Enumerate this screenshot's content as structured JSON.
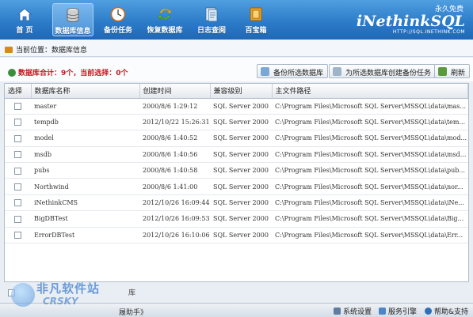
{
  "toolbar": {
    "items": [
      {
        "label": "首 页",
        "icon": "home-icon"
      },
      {
        "label": "数据库信息",
        "icon": "database-icon"
      },
      {
        "label": "备份任务",
        "icon": "clock-icon"
      },
      {
        "label": "恢复数据库",
        "icon": "restore-icon"
      },
      {
        "label": "日志查阅",
        "icon": "log-icon"
      },
      {
        "label": "百宝箱",
        "icon": "toolbox-icon"
      }
    ],
    "active_index": 1
  },
  "brand": {
    "slogan": "永久免费",
    "logo": "iNethinkSQL",
    "url": "HTTP://SQL.INETHINK.COM"
  },
  "breadcrumb": {
    "prefix": "当前位置：",
    "current": "数据库信息"
  },
  "summary": {
    "text": "数据库合计：9个，当前选择：0个"
  },
  "buttons": {
    "backup_selected": "备份所选数据库",
    "create_task": "为所选数据库创建备份任务",
    "refresh": "刷新"
  },
  "table": {
    "columns": [
      "选择",
      "数据库名称",
      "创建时间",
      "兼容级别",
      "主文件路径"
    ],
    "rows": [
      {
        "name": "master",
        "created": "2000/8/6 1:29:12",
        "compat": "SQL Server 2000",
        "path": "C:\\Program Files\\Microsoft SQL Server\\MSSQL\\data\\mas..."
      },
      {
        "name": "tempdb",
        "created": "2012/10/22 15:26:31",
        "compat": "SQL Server 2000",
        "path": "C:\\Program Files\\Microsoft SQL Server\\MSSQL\\data\\tem..."
      },
      {
        "name": "model",
        "created": "2000/8/6 1:40:52",
        "compat": "SQL Server 2000",
        "path": "C:\\Program Files\\Microsoft SQL Server\\MSSQL\\data\\mod..."
      },
      {
        "name": "msdb",
        "created": "2000/8/6 1:40:56",
        "compat": "SQL Server 2000",
        "path": "C:\\Program Files\\Microsoft SQL Server\\MSSQL\\data\\msd..."
      },
      {
        "name": "pubs",
        "created": "2000/8/6 1:40:58",
        "compat": "SQL Server 2000",
        "path": "C:\\Program Files\\Microsoft SQL Server\\MSSQL\\data\\pub..."
      },
      {
        "name": "Northwind",
        "created": "2000/8/6 1:41:00",
        "compat": "SQL Server 2000",
        "path": "C:\\Program Files\\Microsoft SQL Server\\MSSQL\\data\\nor..."
      },
      {
        "name": "iNethinkCMS",
        "created": "2012/10/26 16:09:44",
        "compat": "SQL Server 2000",
        "path": "C:\\Program Files\\Microsoft SQL Server\\MSSQL\\data\\iNe..."
      },
      {
        "name": "BigDBTest",
        "created": "2012/10/26 16:09:53",
        "compat": "SQL Server 2000",
        "path": "C:\\Program Files\\Microsoft SQL Server\\MSSQL\\data\\Big..."
      },
      {
        "name": "ErrorDBTest",
        "created": "2012/10/26 16:10:06",
        "compat": "SQL Server 2000",
        "path": "C:\\Program Files\\Microsoft SQL Server\\MSSQL\\data\\Err..."
      }
    ]
  },
  "footer": {
    "select_all_suffix": "库",
    "status_text": "履助手》",
    "links": {
      "settings": "系统设置",
      "service": "服务引擎",
      "help": "帮助&支持"
    }
  },
  "watermark": {
    "main": "非凡软件站",
    "sub": "CRSKY"
  },
  "colors": {
    "toolbar_blue": "#2d7cc9",
    "summary_red": "#c4161c",
    "brand_white": "#ffffff"
  }
}
